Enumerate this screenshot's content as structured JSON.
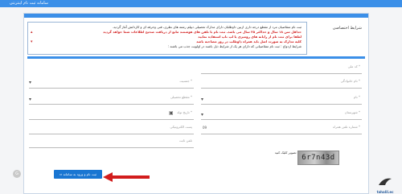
{
  "header": {
    "title": "سامانه ثبت نام اینترنتی"
  },
  "rules": {
    "label": "شرایط اختصاصی",
    "lines": [
      "ثبت نام متقاضیان مرد از مقطع درجه داری ازبین داوطلبان دارای مدارک تحصیلی دیپلم رشته های نظری، فنی وحرفه ای و کاردانش آغاز گردید.",
      "حداقل سن ۱۸ سال و حداکثر ۲۵ سال می باشد. ثبت نام با تلفن های هوشمند مانع از دریافت صحیح اطلاعات شما خواهد گردید",
      "لطفا برای ثبت نام از رایانه های رومیزی یا لپ تاپ استفاده نمایید",
      "کلیه مدارک به صورت اصل باید همراه داوطلب در روز مصاحبه باشد",
      "شرایط ازدواج : ثبت نام متقاضیانی که دارای هر یک از شرایط ذیل باشند در اولویت جذب می باشند :"
    ],
    "red_line_index": 2
  },
  "form": {
    "fields": {
      "first_name": "نام *",
      "last_name": "نام خانوادگی *",
      "national_code": "کد ملی *",
      "father_name": "نام پدر *",
      "gender": "جنسیت *",
      "birth_place": "محل تولد *",
      "province": "استان *",
      "city": "شهرستان *",
      "education": "مقطع تحصیلی *",
      "birth_date": "تاریخ تولد *",
      "mobile": "شماره تلفن همراه *",
      "email": "پست الکترونیکی",
      "email_prefix": "09",
      "major": "رشته تحصیلی *",
      "phone": "تلفن ثابت",
      "grade": "معدل"
    },
    "captcha": {
      "label": "برای ورود رمز نمایش تصویر کلیک کنید",
      "value": "6r7n43d"
    },
    "submit_label": "ثبت نام و ورود به سامانه"
  },
  "watermark": {
    "text": "tahalil.ec"
  },
  "colors": {
    "primary": "#3b8fe8",
    "button": "#1976d2",
    "arrow": "#d21c1c"
  }
}
